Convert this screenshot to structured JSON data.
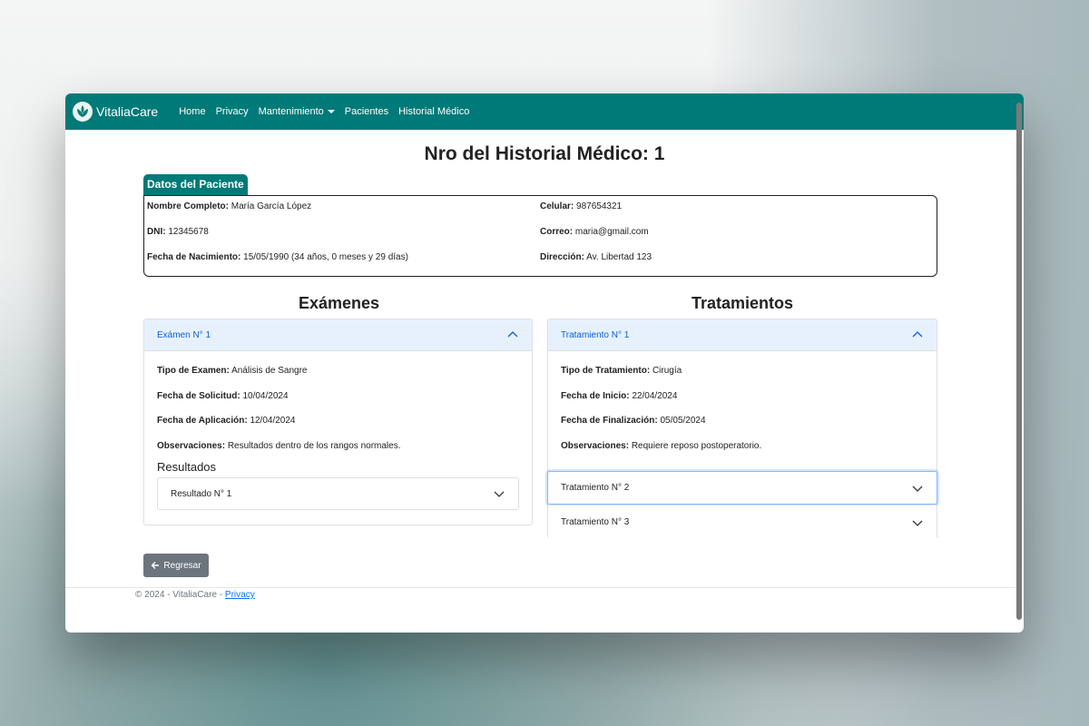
{
  "navbar": {
    "brand": "VitaliaCare",
    "links": [
      "Home",
      "Privacy",
      "Mantenimiento",
      "Pacientes",
      "Historial Médico"
    ]
  },
  "page": {
    "title": "Nro del Historial Médico: 1"
  },
  "patient": {
    "tab_label": "Datos del Paciente",
    "fields": {
      "nombre_label": "Nombre Completo:",
      "nombre_value": "María García López",
      "dni_label": "DNI:",
      "dni_value": "12345678",
      "nacimiento_label": "Fecha de Nacimiento:",
      "nacimiento_value": "15/05/1990 (34 años, 0 meses y 29 días)",
      "celular_label": "Celular:",
      "celular_value": "987654321",
      "correo_label": "Correo:",
      "correo_value": "maria@gmail.com",
      "direccion_label": "Dirección:",
      "direccion_value": "Av. Libertad 123"
    }
  },
  "examenes": {
    "title": "Exámenes",
    "item_header": "Exámen N° 1",
    "rows": [
      {
        "label": "Tipo de Examen:",
        "value": "Análisis de Sangre"
      },
      {
        "label": "Fecha de Solicitud:",
        "value": "10/04/2024"
      },
      {
        "label": "Fecha de Aplicación:",
        "value": "12/04/2024"
      },
      {
        "label": "Observaciones:",
        "value": "Resultados dentro de los rangos normales."
      }
    ],
    "resultados_title": "Resultados",
    "resultado_item": "Resultado N° 1"
  },
  "tratamientos": {
    "title": "Tratamientos",
    "item_header": "Tratamiento N° 1",
    "rows": [
      {
        "label": "Tipo de Tratamiento:",
        "value": "Cirugía"
      },
      {
        "label": "Fecha de Inicio:",
        "value": "22/04/2024"
      },
      {
        "label": "Fecha de Finalización:",
        "value": "05/05/2024"
      },
      {
        "label": "Observaciones:",
        "value": "Requiere reposo postoperatorio."
      }
    ],
    "item2": "Tratamiento N° 2",
    "item3": "Tratamiento N° 3"
  },
  "actions": {
    "back_label": "Regresar"
  },
  "footer": {
    "text": "© 2024 - VitaliaCare - ",
    "privacy_link": "Privacy"
  },
  "colors": {
    "brand": "#007a78",
    "accordion_header_bg": "#e7f1fd",
    "accordion_header_text": "#0b5ed7",
    "button_secondary": "#6c757d"
  }
}
